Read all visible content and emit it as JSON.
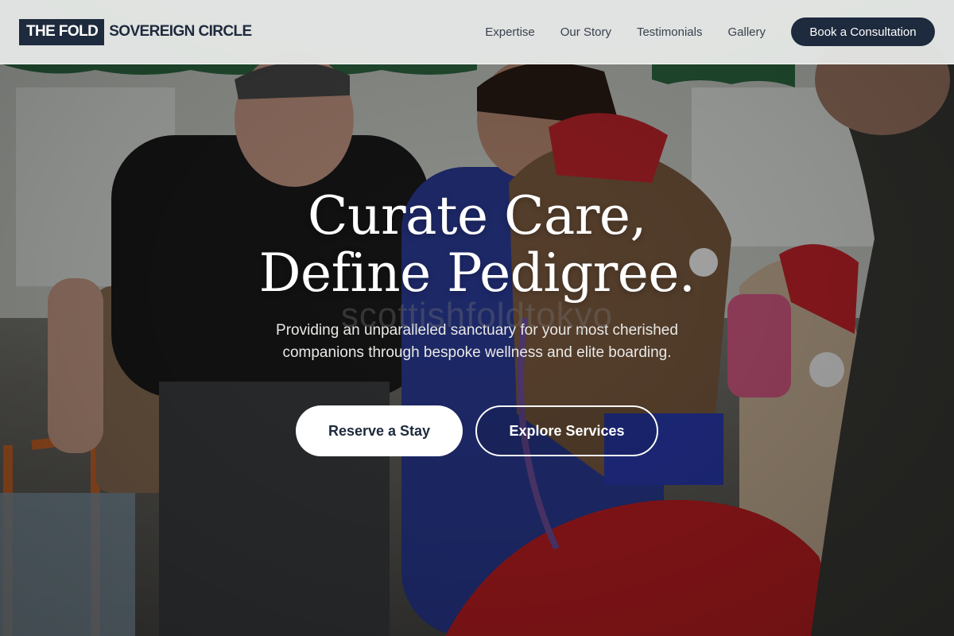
{
  "brand": {
    "mark": "THE FOLD",
    "name": "SOVEREIGN CIRCLE"
  },
  "nav": {
    "links": [
      "Expertise",
      "Our Story",
      "Testimonials",
      "Gallery"
    ],
    "cta": "Book a Consultation"
  },
  "hero": {
    "headline_line1": "Curate Care,",
    "headline_line2": "Define Pedigree.",
    "watermark": "scottishfoldtokyo",
    "subtitle": "Providing an unparalleled sanctuary for your most cherished companions through bespoke wellness and elite boarding.",
    "primary_button": "Reserve a Stay",
    "secondary_button": "Explore Services",
    "background_image": "photo: elderly man with cap, caregiver in blue scrubs, alpacas wearing Santa hats"
  },
  "colors": {
    "navy": "#1e2a3d",
    "nav_bg": "#e8ecea",
    "white": "#ffffff"
  }
}
